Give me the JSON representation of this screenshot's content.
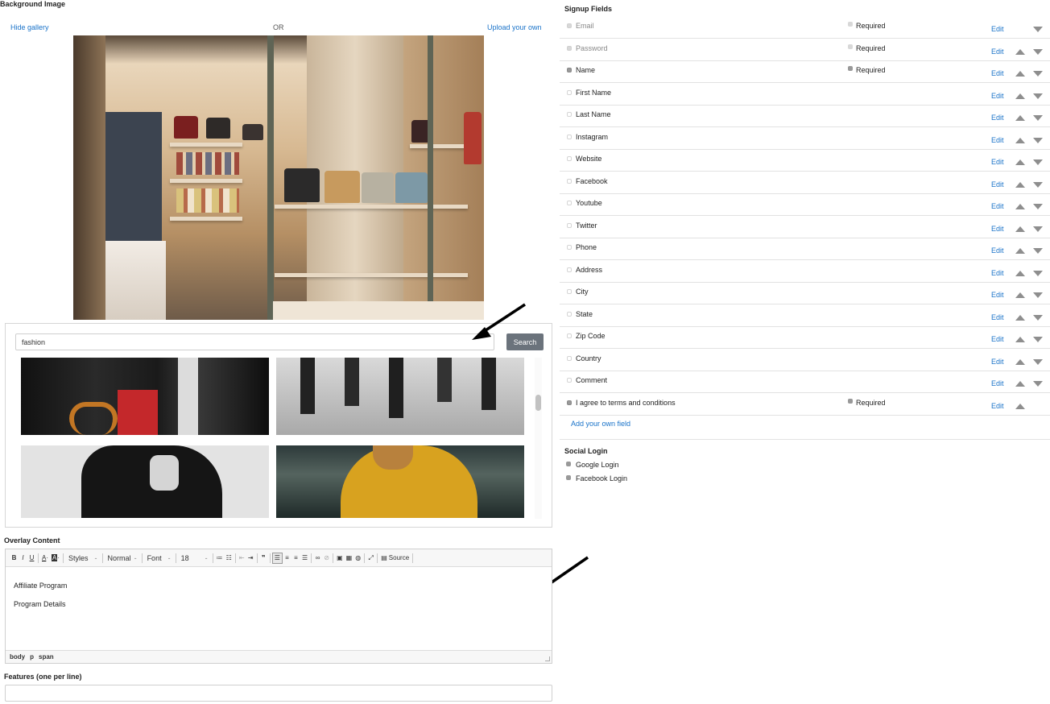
{
  "background": {
    "title": "Background Image",
    "hide_gallery": "Hide gallery",
    "or": "OR",
    "upload_own": "Upload your own"
  },
  "gallery": {
    "search_value": "fashion",
    "search_button": "Search"
  },
  "overlay": {
    "title": "Overlay Content",
    "toolbar": {
      "bold": "B",
      "italic": "I",
      "underline": "U",
      "styles": "Styles",
      "format": "Normal",
      "font": "Font",
      "size": "18",
      "source": "Source"
    },
    "body_lines": [
      "Affiliate Program",
      "Program Details"
    ],
    "status_path": [
      "body",
      "p",
      "span"
    ]
  },
  "features": {
    "title": "Features (one per line)",
    "value": ""
  },
  "signup": {
    "title": "Signup Fields",
    "edit_label": "Edit",
    "required_label": "Required",
    "fields": [
      {
        "label": "Email",
        "enabled": "dim",
        "required": "dim",
        "muted": true,
        "up": false,
        "down": true
      },
      {
        "label": "Password",
        "enabled": "dim",
        "required": "dim",
        "muted": true,
        "up": true,
        "down": true
      },
      {
        "label": "Name",
        "enabled": "on",
        "required": "on",
        "muted": false,
        "up": true,
        "down": true
      },
      {
        "label": "First Name",
        "enabled": "off",
        "required": "none",
        "muted": false,
        "up": true,
        "down": true
      },
      {
        "label": "Last Name",
        "enabled": "off",
        "required": "none",
        "muted": false,
        "up": true,
        "down": true
      },
      {
        "label": "Instagram",
        "enabled": "off",
        "required": "none",
        "muted": false,
        "up": true,
        "down": true
      },
      {
        "label": "Website",
        "enabled": "off",
        "required": "none",
        "muted": false,
        "up": true,
        "down": true
      },
      {
        "label": "Facebook",
        "enabled": "off",
        "required": "none",
        "muted": false,
        "up": true,
        "down": true
      },
      {
        "label": "Youtube",
        "enabled": "off",
        "required": "none",
        "muted": false,
        "up": true,
        "down": true
      },
      {
        "label": "Twitter",
        "enabled": "off",
        "required": "none",
        "muted": false,
        "up": true,
        "down": true
      },
      {
        "label": "Phone",
        "enabled": "off",
        "required": "none",
        "muted": false,
        "up": true,
        "down": true
      },
      {
        "label": "Address",
        "enabled": "off",
        "required": "none",
        "muted": false,
        "up": true,
        "down": true
      },
      {
        "label": "City",
        "enabled": "off",
        "required": "none",
        "muted": false,
        "up": true,
        "down": true
      },
      {
        "label": "State",
        "enabled": "off",
        "required": "none",
        "muted": false,
        "up": true,
        "down": true
      },
      {
        "label": "Zip Code",
        "enabled": "off",
        "required": "none",
        "muted": false,
        "up": true,
        "down": true
      },
      {
        "label": "Country",
        "enabled": "off",
        "required": "none",
        "muted": false,
        "up": true,
        "down": true
      },
      {
        "label": "Comment",
        "enabled": "off",
        "required": "none",
        "muted": false,
        "up": true,
        "down": true
      },
      {
        "label": "I agree to terms and conditions",
        "enabled": "on",
        "required": "on",
        "muted": false,
        "up": true,
        "down": false
      }
    ],
    "add_field": "Add your own field"
  },
  "social": {
    "title": "Social Login",
    "items": [
      "Google Login",
      "Facebook Login"
    ]
  },
  "colors": {
    "link": "#1a73c9",
    "search_button_bg": "#6b737c",
    "arrow": "#8e8e8e"
  }
}
